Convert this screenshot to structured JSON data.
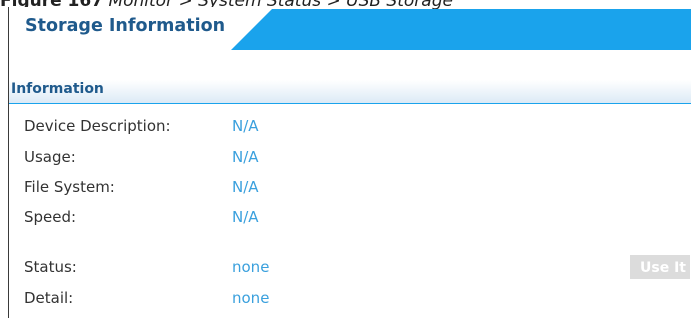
{
  "caption": {
    "number": "Figure 167",
    "text": "Monitor > System Status > USB Storage"
  },
  "tab": {
    "label": "Storage Information"
  },
  "section": {
    "label": "Information"
  },
  "rows": [
    {
      "label": "Device Description:",
      "value": "N/A"
    },
    {
      "label": "Usage:",
      "value": "N/A"
    },
    {
      "label": "File System:",
      "value": "N/A"
    },
    {
      "label": "Speed:",
      "value": "N/A"
    },
    {
      "label": "Status:",
      "value": "none"
    },
    {
      "label": "Detail:",
      "value": "none"
    }
  ],
  "use_button": {
    "label": "Use It"
  },
  "colors": {
    "accent": "#1aa3ec",
    "heading": "#1f5a8c",
    "value": "#3aa0dd",
    "disabled_button": "#dcdcdc"
  }
}
